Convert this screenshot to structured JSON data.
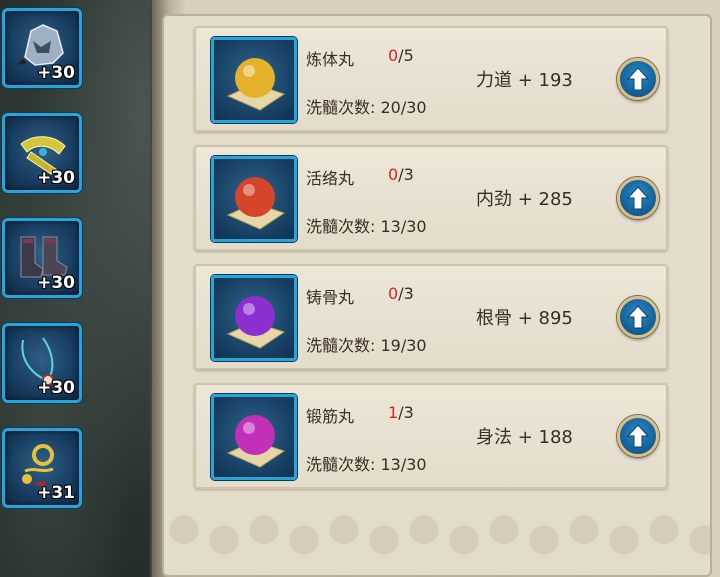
{
  "equipment": [
    {
      "icon": "helmet-icon",
      "level": "+30"
    },
    {
      "icon": "belt-icon",
      "level": "+30"
    },
    {
      "icon": "boots-icon",
      "level": "+30"
    },
    {
      "icon": "necklace-icon",
      "level": "+30"
    },
    {
      "icon": "ring-icon",
      "level": "+31"
    }
  ],
  "pills": [
    {
      "name": "炼体丸",
      "current": "0",
      "max": "/5",
      "washes": "洗髓次数: 20/30",
      "stat": "力道 + 193",
      "color": "#e5b12a"
    },
    {
      "name": "活络丸",
      "current": "0",
      "max": "/3",
      "washes": "洗髓次数: 13/30",
      "stat": "内劲 + 285",
      "color": "#d4452a"
    },
    {
      "name": "铸骨丸",
      "current": "0",
      "max": "/3",
      "washes": "洗髓次数: 19/30",
      "stat": "根骨 + 895",
      "color": "#8c2fd0"
    },
    {
      "name": "锻筋丸",
      "current": "1",
      "max": "/3",
      "washes": "洗髓次数: 13/30",
      "stat": "身法 + 188",
      "color": "#c22fb8"
    }
  ],
  "colors": {
    "accent_blue": "#2aa3d8",
    "highlight_red": "#d8261e",
    "panel": "#e3dccb"
  }
}
